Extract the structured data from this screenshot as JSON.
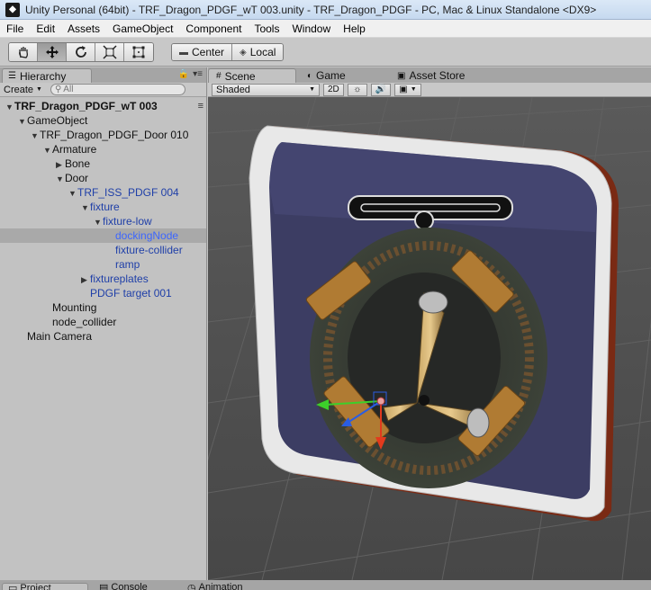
{
  "window": {
    "title": "Unity Personal (64bit) - TRF_Dragon_PDGF_wT 003.unity - TRF_Dragon_PDGF - PC, Mac & Linux Standalone <DX9>"
  },
  "menu": [
    "File",
    "Edit",
    "Assets",
    "GameObject",
    "Component",
    "Tools",
    "Window",
    "Help"
  ],
  "toolbar": {
    "tools": [
      {
        "name": "hand-tool",
        "glyph": "✋"
      },
      {
        "name": "move-tool",
        "glyph": "✥"
      },
      {
        "name": "rotate-tool",
        "glyph": "↻"
      },
      {
        "name": "scale-tool",
        "glyph": "⤢"
      },
      {
        "name": "rect-tool",
        "glyph": "⊡"
      }
    ],
    "pivot_label": "Center",
    "space_label": "Local"
  },
  "hierarchy": {
    "tab_label": "Hierarchy",
    "create_label": "Create",
    "search_placeholder": "All",
    "items": [
      {
        "label": "TRF_Dragon_PDGF_wT 003",
        "depth": 0,
        "arrow": "▼",
        "style": "bold",
        "selected": false
      },
      {
        "label": "GameObject",
        "depth": 1,
        "arrow": "▼",
        "style": "normal",
        "selected": false
      },
      {
        "label": "TRF_Dragon_PDGF_Door 010",
        "depth": 2,
        "arrow": "▼",
        "style": "normal",
        "selected": false
      },
      {
        "label": "Armature",
        "depth": 3,
        "arrow": "▼",
        "style": "normal",
        "selected": false
      },
      {
        "label": "Bone",
        "depth": 4,
        "arrow": "▶",
        "style": "normal",
        "selected": false
      },
      {
        "label": "Door",
        "depth": 4,
        "arrow": "▼",
        "style": "normal",
        "selected": false
      },
      {
        "label": "TRF_ISS_PDGF 004",
        "depth": 5,
        "arrow": "▼",
        "style": "blue",
        "selected": false
      },
      {
        "label": "fixture",
        "depth": 6,
        "arrow": "▼",
        "style": "blue",
        "selected": false
      },
      {
        "label": "fixture-low",
        "depth": 7,
        "arrow": "▼",
        "style": "blue",
        "selected": false
      },
      {
        "label": "dockingNode",
        "depth": 8,
        "arrow": "",
        "style": "blue",
        "selected": true
      },
      {
        "label": "fixture-collider",
        "depth": 8,
        "arrow": "",
        "style": "blue",
        "selected": false
      },
      {
        "label": "ramp",
        "depth": 8,
        "arrow": "",
        "style": "blue",
        "selected": false
      },
      {
        "label": "fixtureplates",
        "depth": 6,
        "arrow": "▶",
        "style": "blue",
        "selected": false
      },
      {
        "label": "PDGF target 001",
        "depth": 6,
        "arrow": "",
        "style": "blue",
        "selected": false
      },
      {
        "label": "Mounting",
        "depth": 3,
        "arrow": "",
        "style": "normal",
        "selected": false
      },
      {
        "label": "node_collider",
        "depth": 3,
        "arrow": "",
        "style": "normal",
        "selected": false
      },
      {
        "label": "Main Camera",
        "depth": 1,
        "arrow": "",
        "style": "normal",
        "selected": false
      }
    ]
  },
  "scene": {
    "tabs": [
      {
        "label": "Scene",
        "icon": "#",
        "active": true
      },
      {
        "label": "Game",
        "icon": "◐",
        "active": false
      },
      {
        "label": "Asset Store",
        "icon": "🛍",
        "active": false
      }
    ],
    "shading": "Shaded",
    "mode_2d": "2D"
  },
  "bottom_tabs": [
    "Project",
    "Console",
    "Animation"
  ],
  "colors": {
    "selection": "#a9a9a9",
    "prefab_blue": "#1f3fa8",
    "viewport_bg": "#505050"
  }
}
